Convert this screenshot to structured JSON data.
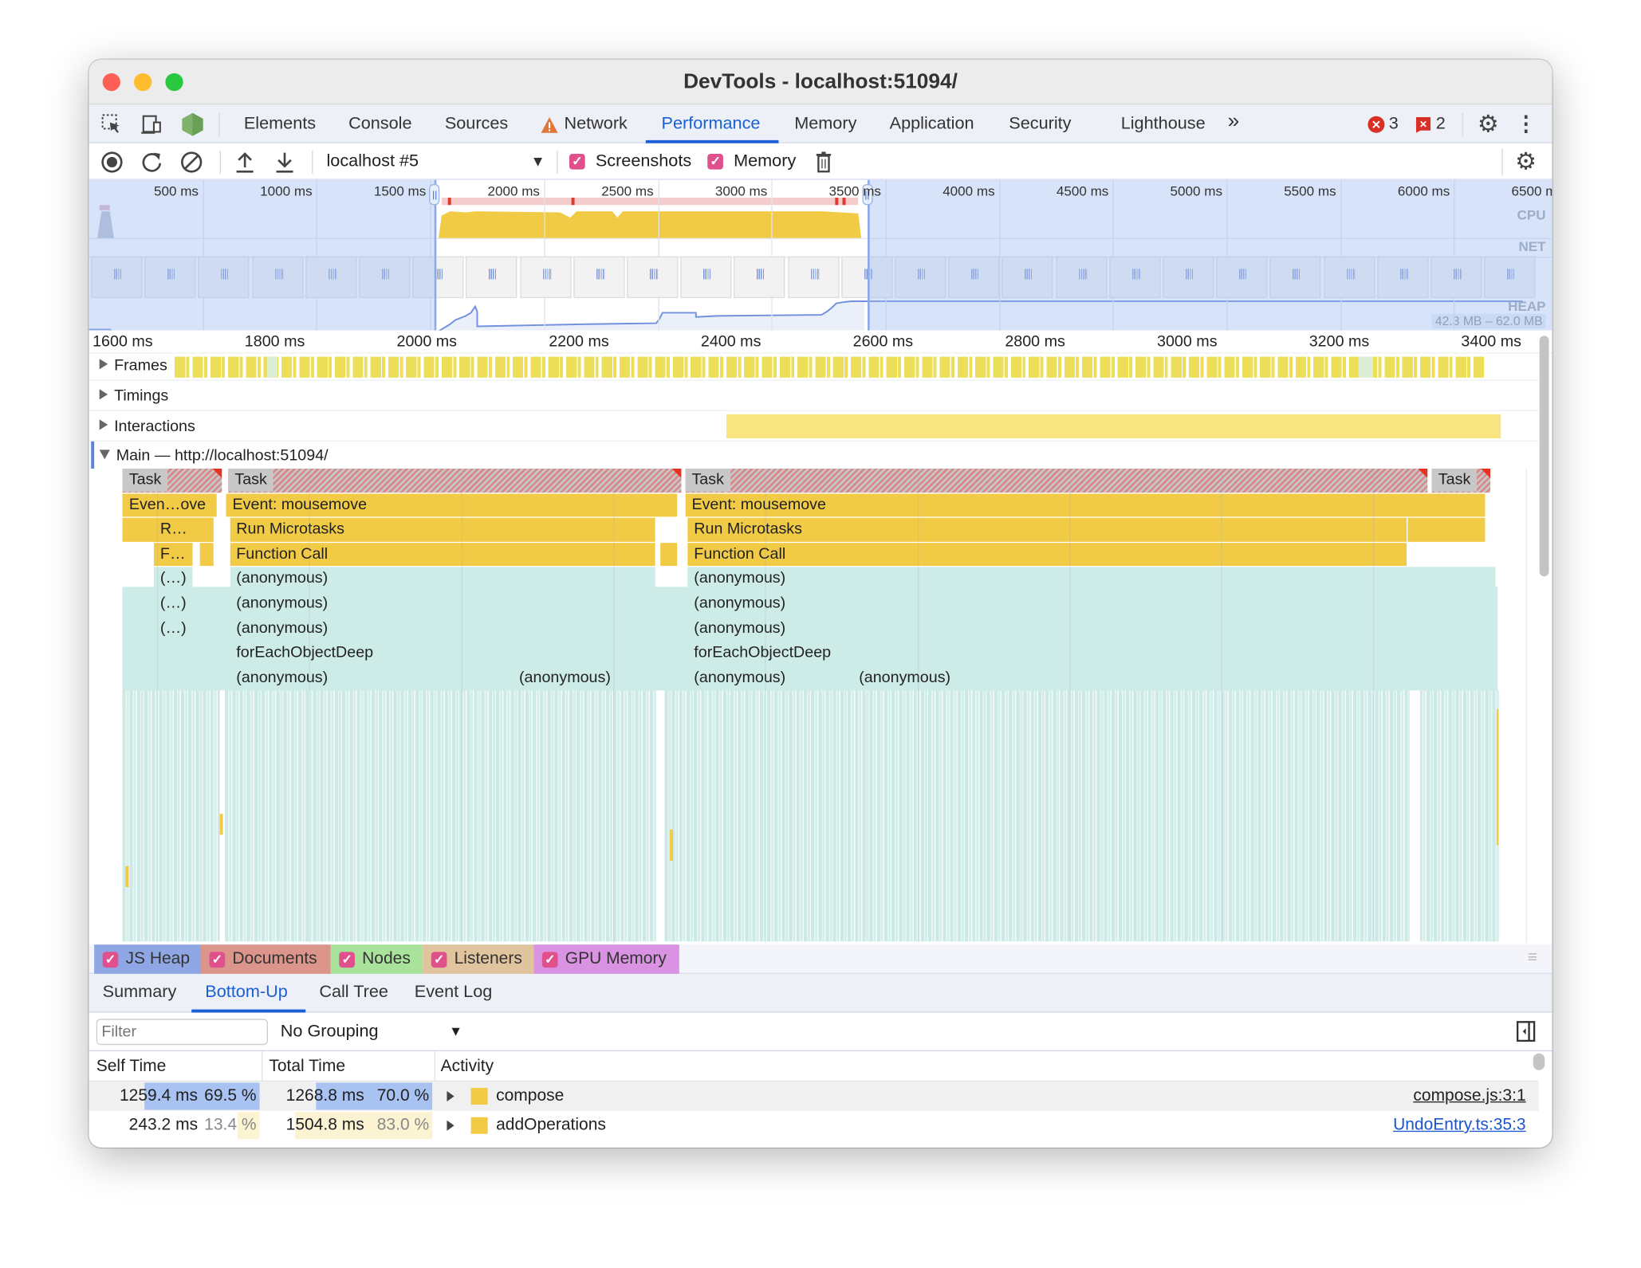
{
  "window": {
    "title": "DevTools - localhost:51094/"
  },
  "tabs": [
    {
      "label": "Elements"
    },
    {
      "label": "Console"
    },
    {
      "label": "Sources"
    },
    {
      "label": "Network",
      "icon": "warning-icon"
    },
    {
      "label": "Performance",
      "active": true
    },
    {
      "label": "Memory"
    },
    {
      "label": "Application"
    },
    {
      "label": "Security"
    },
    {
      "label": "Lighthouse"
    }
  ],
  "more_tabs": "»",
  "status": {
    "errors": "3",
    "issues": "2"
  },
  "toolbar": {
    "profile_select": "localhost #5",
    "screenshots_label": "Screenshots",
    "screenshots_checked": true,
    "memory_label": "Memory",
    "memory_checked": true
  },
  "overview": {
    "ticks": [
      "500 ms",
      "1000 ms",
      "1500 ms",
      "2000 ms",
      "2500 ms",
      "3000 ms",
      "3500 ms",
      "4000 ms",
      "4500 ms",
      "5000 ms",
      "5500 ms",
      "6000 ms",
      "6500 ms"
    ],
    "cpu_label": "CPU",
    "net_label": "NET",
    "heap_label": "HEAP",
    "heap_range": "42.3 MB – 62.0 MB",
    "selection_ms": [
      1520,
      3420
    ]
  },
  "flame_ruler": [
    "1600 ms",
    "1800 ms",
    "2000 ms",
    "2200 ms",
    "2400 ms",
    "2600 ms",
    "2800 ms",
    "3000 ms",
    "3200 ms",
    "3400 ms"
  ],
  "tracks": {
    "frames": "Frames",
    "timings": "Timings",
    "interactions": "Interactions",
    "main": "Main — http://localhost:51094/"
  },
  "flame": [
    {
      "row": 0,
      "kind": "task",
      "start": 1555,
      "end": 1687,
      "label": "Task"
    },
    {
      "row": 0,
      "kind": "task",
      "start": 1694,
      "end": 2291,
      "label": "Task"
    },
    {
      "row": 0,
      "kind": "task",
      "start": 2295,
      "end": 3272,
      "label": "Task"
    },
    {
      "row": 0,
      "kind": "task",
      "start": 3277,
      "end": 3355,
      "label": "Task"
    },
    {
      "row": 1,
      "kind": "ev",
      "start": 1555,
      "end": 1680,
      "label": "Even…ove"
    },
    {
      "row": 1,
      "kind": "ev",
      "start": 1691,
      "end": 2285,
      "label": "Event: mousemove"
    },
    {
      "row": 1,
      "kind": "ev",
      "start": 2295,
      "end": 3348,
      "label": "Event: mousemove"
    },
    {
      "row": 2,
      "kind": "ev",
      "start": 1555,
      "end": 1676,
      "label": ""
    },
    {
      "row": 2,
      "kind": "ev",
      "start": 1596,
      "end": 1676,
      "label": "R…"
    },
    {
      "row": 2,
      "kind": "ev",
      "start": 1696,
      "end": 2257,
      "label": "Run Microtasks"
    },
    {
      "row": 2,
      "kind": "ev",
      "start": 2298,
      "end": 3245,
      "label": "Run Microtasks"
    },
    {
      "row": 2,
      "kind": "ev",
      "start": 3245,
      "end": 3348,
      "label": ""
    },
    {
      "row": 3,
      "kind": "ev",
      "start": 1596,
      "end": 1648,
      "label": "F…"
    },
    {
      "row": 3,
      "kind": "ev",
      "start": 1656,
      "end": 1676,
      "label": ""
    },
    {
      "row": 3,
      "kind": "ev",
      "start": 1696,
      "end": 2257,
      "label": "Function Call"
    },
    {
      "row": 3,
      "kind": "ev",
      "start": 2262,
      "end": 2285,
      "label": ""
    },
    {
      "row": 3,
      "kind": "ev",
      "start": 2298,
      "end": 3245,
      "label": "Function Call"
    },
    {
      "row": 4,
      "kind": "js",
      "start": 1596,
      "end": 1648,
      "label": "(…)"
    },
    {
      "row": 4,
      "kind": "js",
      "start": 1696,
      "end": 2257,
      "label": "(anonymous)"
    },
    {
      "row": 4,
      "kind": "js",
      "start": 2298,
      "end": 3362,
      "label": "(anonymous)"
    },
    {
      "row": 5,
      "kind": "js",
      "start": 1596,
      "end": 1648,
      "label": "(…)"
    },
    {
      "row": 5,
      "kind": "js",
      "start": 1696,
      "end": 2257,
      "label": "(anonymous)"
    },
    {
      "row": 5,
      "kind": "js",
      "start": 2298,
      "end": 3362,
      "label": "(anonymous)"
    },
    {
      "row": 6,
      "kind": "js",
      "start": 1596,
      "end": 1648,
      "label": "(…)"
    },
    {
      "row": 6,
      "kind": "js",
      "start": 1696,
      "end": 2257,
      "label": "(anonymous)"
    },
    {
      "row": 6,
      "kind": "js",
      "start": 2298,
      "end": 3362,
      "label": "(anonymous)"
    },
    {
      "row": 7,
      "kind": "js",
      "start": 1696,
      "end": 2257,
      "label": "forEachObjectDeep"
    },
    {
      "row": 7,
      "kind": "js",
      "start": 2298,
      "end": 3362,
      "label": "forEachObjectDeep"
    },
    {
      "row": 8,
      "kind": "js",
      "start": 1696,
      "end": 2068,
      "label": "(anonymous)"
    },
    {
      "row": 8,
      "kind": "js",
      "start": 2068,
      "end": 2257,
      "label": "(anonymous)"
    },
    {
      "row": 8,
      "kind": "js",
      "start": 2298,
      "end": 2515,
      "label": "(anonymous)"
    },
    {
      "row": 8,
      "kind": "js",
      "start": 2515,
      "end": 3362,
      "label": "(anonymous)"
    }
  ],
  "memory_legend": [
    {
      "label": "JS Heap",
      "color": "#8ea6e4"
    },
    {
      "label": "Documents",
      "color": "#dc958b"
    },
    {
      "label": "Nodes",
      "color": "#a9e39b"
    },
    {
      "label": "Listeners",
      "color": "#e0c49d"
    },
    {
      "label": "GPU Memory",
      "color": "#da93e2"
    }
  ],
  "bottom_tabs": [
    {
      "label": "Summary"
    },
    {
      "label": "Bottom-Up",
      "active": true
    },
    {
      "label": "Call Tree"
    },
    {
      "label": "Event Log"
    }
  ],
  "filter": {
    "placeholder": "Filter",
    "grouping": "No Grouping"
  },
  "table": {
    "headers": [
      "Self Time",
      "Total Time",
      "Activity"
    ],
    "rows": [
      {
        "self_ms": "1259.4 ms",
        "self_pct": "69.5 %",
        "total_ms": "1268.8 ms",
        "total_pct": "70.0 %",
        "activity": "compose",
        "source": "compose.js:3:1",
        "self_frac": 0.695,
        "total_frac": 0.7
      },
      {
        "self_ms": "243.2 ms",
        "self_pct": "13.4 %",
        "total_ms": "1504.8 ms",
        "total_pct": "83.0 %",
        "activity": "addOperations",
        "source": "UndoEntry.ts:35:3",
        "self_frac": 0.134,
        "total_frac": 0.83
      }
    ]
  }
}
